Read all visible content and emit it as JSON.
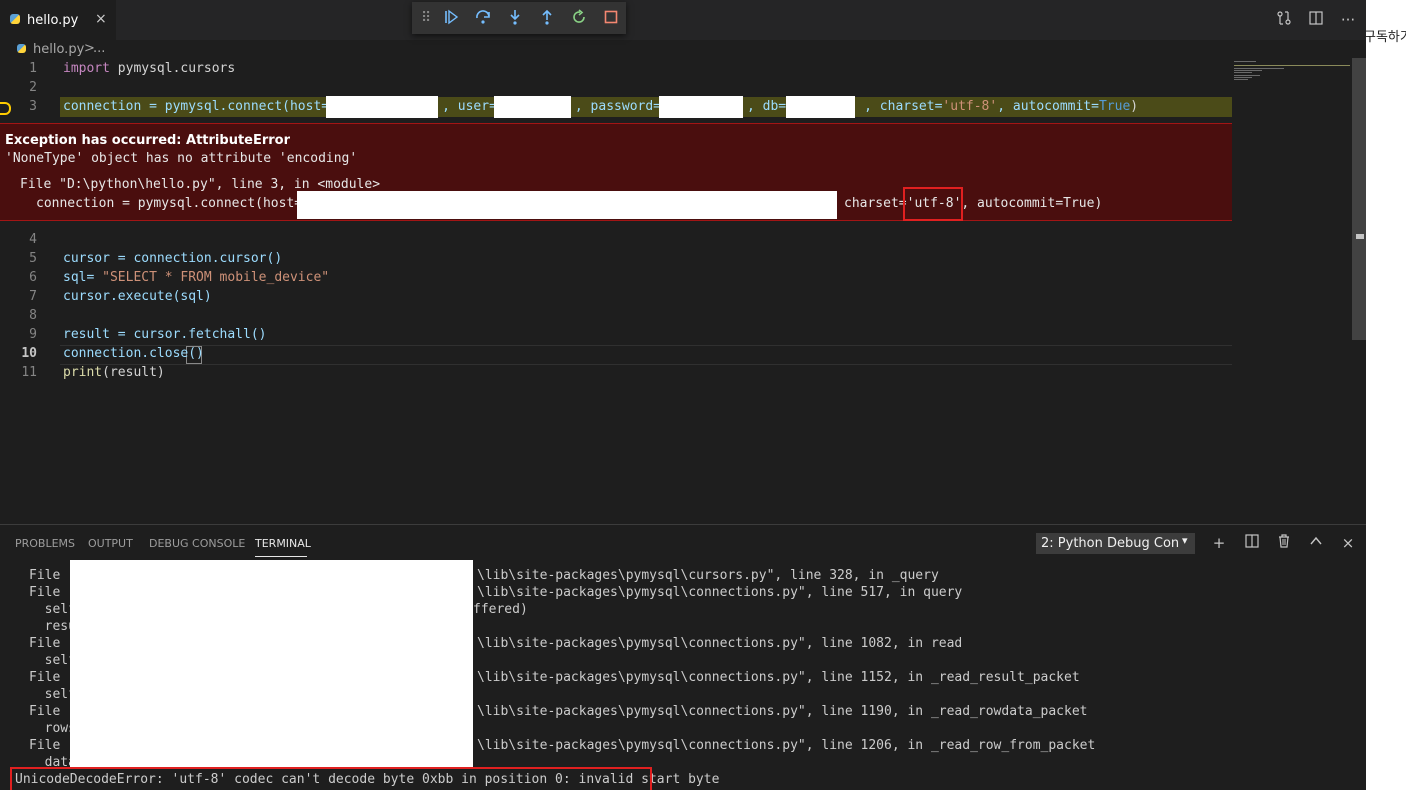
{
  "tab": {
    "filename": "hello.py",
    "close_glyph": "×"
  },
  "editor_actions": {
    "compare_icon": "source-control-icon",
    "split_icon": "split-editor-icon",
    "more_glyph": "···"
  },
  "debug_toolbar": {
    "grip_glyph": "⠿",
    "continue": "continue-icon",
    "step_over": "step-over-icon",
    "step_into": "step-into-icon",
    "step_out": "step-out-icon",
    "restart": "restart-icon",
    "stop": "stop-icon"
  },
  "breadcrumb": {
    "file": "hello.py",
    "separator": ">",
    "more": "..."
  },
  "editor": {
    "lines": [
      {
        "n": "1"
      },
      {
        "n": "2"
      },
      {
        "n": "3"
      },
      {
        "n": "4"
      },
      {
        "n": "5"
      },
      {
        "n": "6"
      },
      {
        "n": "7"
      },
      {
        "n": "8"
      },
      {
        "n": "9"
      },
      {
        "n": "10"
      },
      {
        "n": "11"
      }
    ],
    "line1": {
      "kw": "import",
      "rest": " pymysql.cursors"
    },
    "line3": {
      "a": "connection = pymysql.connect(host=",
      "b": ", user=",
      "c": ", password=",
      "d": ", db=",
      "e": ", charset=",
      "f": "'utf-8'",
      "g": ", autocommit=",
      "h": "True",
      "i": ")"
    },
    "line5": "cursor = connection.cursor()",
    "line6": {
      "a": "sql= ",
      "b": "\"SELECT * FROM mobile_device\""
    },
    "line7": "cursor.execute(sql)",
    "line9": "result = cursor.fetchall()",
    "line10": "connection.close()",
    "line11": {
      "a": "print",
      "b": "(result)"
    }
  },
  "exception": {
    "title": "Exception has occurred: AttributeError",
    "message": "'NoneType' object has no attribute 'encoding'",
    "file_line": "File \"D:\\python\\hello.py\", line 3, in <module>",
    "code_start": "connection = pymysql.connect(host=",
    "code_end": "charset='utf-8', autocommit=True)"
  },
  "panel": {
    "tabs": [
      "PROBLEMS",
      "OUTPUT",
      "DEBUG CONSOLE",
      "TERMINAL"
    ],
    "terminal_select": "2: Python Debug Console",
    "select_arrow": "▾",
    "icons": {
      "new_terminal": "+",
      "split": "split-terminal-icon",
      "trash": "trash-icon",
      "maximize": "^",
      "close": "×"
    },
    "terminal_lines": [
      {
        "left": "File \"",
        "right": "\\lib\\site-packages\\pymysql\\cursors.py\", line 328, in _query"
      },
      {
        "left": "File \"",
        "right": "\\lib\\site-packages\\pymysql\\connections.py\", line 517, in query"
      },
      {
        "left": "  self",
        "right": "ffered)"
      },
      {
        "left": "  resu",
        "right": ""
      },
      {
        "left": "File \"",
        "right": "\\lib\\site-packages\\pymysql\\connections.py\", line 1082, in read"
      },
      {
        "left": "  self",
        "right": ""
      },
      {
        "left": "File \"",
        "right": "\\lib\\site-packages\\pymysql\\connections.py\", line 1152, in _read_result_packet"
      },
      {
        "left": "  self",
        "right": ""
      },
      {
        "left": "File \"",
        "right": "\\lib\\site-packages\\pymysql\\connections.py\", line 1190, in _read_rowdata_packet"
      },
      {
        "left": "  rows",
        "right": ""
      },
      {
        "left": "File \"",
        "right": "\\lib\\site-packages\\pymysql\\connections.py\", line 1206, in _read_row_from_packet"
      },
      {
        "left": "  data",
        "right": ""
      }
    ],
    "error_line": "UnicodeDecodeError: 'utf-8' codec can't decode byte 0xbb in position 0: invalid start byte"
  },
  "side_text": "구독하기"
}
